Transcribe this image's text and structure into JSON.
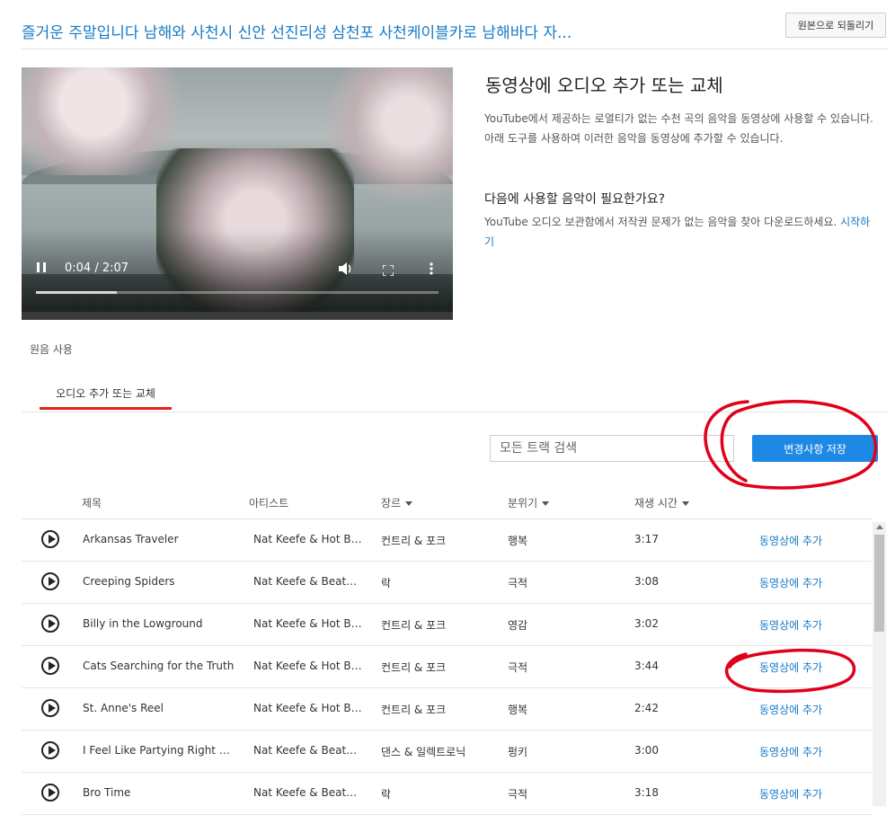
{
  "header": {
    "video_title": "즐거운 주말입니다 남해와 사천시 신안 선진리성 삼천포 사천케이블카로 남해바다 자...",
    "revert_label": "원본으로 되돌리기"
  },
  "player": {
    "time": "0:04 / 2:07",
    "progress": 0.2
  },
  "panel": {
    "title": "동영상에 오디오 추가 또는 교체",
    "description": "YouTube에서 제공하는 로열티가 없는 수천 곡의 음악을 동영상에 사용할 수 있습니다. 아래 도구를 사용하여 이러한 음악을 동영상에 추가할 수 있습니다.",
    "need_title": "다음에 사용할 음악이 필요한가요?",
    "need_desc": "YouTube 오디오 보관함에서 저작권 문제가 없는 음악을 찾아 다운로드하세요.",
    "start_link": "시작하기"
  },
  "tabs": {
    "original": "원음 사용",
    "replace": "오디오 추가 또는 교체"
  },
  "search": {
    "placeholder": "모든 트랙 검색"
  },
  "save_label": "변경사항 저장",
  "table": {
    "headers": {
      "title": "제목",
      "artist": "아티스트",
      "genre": "장르",
      "mood": "분위기",
      "duration": "재생 시간"
    },
    "add_label": "동영상에 추가",
    "rows": [
      {
        "title": "Arkansas Traveler",
        "artist": "Nat Keefe & Hot Bu...",
        "genre": "컨트리 & 포크",
        "mood": "행복",
        "duration": "3:17"
      },
      {
        "title": "Creeping Spiders",
        "artist": "Nat Keefe & BeatM...",
        "genre": "락",
        "mood": "극적",
        "duration": "3:08"
      },
      {
        "title": "Billy in the Lowground",
        "artist": "Nat Keefe & Hot Bu...",
        "genre": "컨트리 & 포크",
        "mood": "영감",
        "duration": "3:02"
      },
      {
        "title": "Cats Searching for the Truth",
        "artist": "Nat Keefe & Hot Bu...",
        "genre": "컨트리 & 포크",
        "mood": "극적",
        "duration": "3:44"
      },
      {
        "title": "St. Anne's Reel",
        "artist": "Nat Keefe & Hot Bu...",
        "genre": "컨트리 & 포크",
        "mood": "행복",
        "duration": "2:42"
      },
      {
        "title": "I Feel Like Partying Right N...",
        "artist": "Nat Keefe & BeatM...",
        "genre": "댄스 & 일렉트로닉",
        "mood": "펑키",
        "duration": "3:00"
      },
      {
        "title": "Bro Time",
        "artist": "Nat Keefe & BeatM...",
        "genre": "락",
        "mood": "극적",
        "duration": "3:18"
      }
    ]
  },
  "colors": {
    "accent_blue": "#167ac6",
    "save_blue": "#1e88e5",
    "tab_red": "#e62117",
    "annotation_red": "#e0001a"
  }
}
